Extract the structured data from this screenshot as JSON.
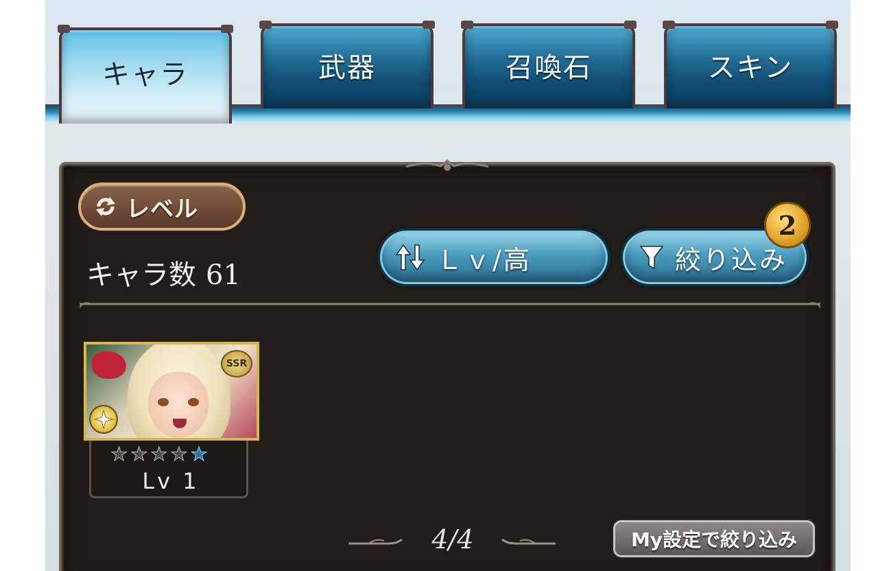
{
  "tabs": [
    {
      "label": "キャラ",
      "active": true
    },
    {
      "label": "武器",
      "active": false
    },
    {
      "label": "召喚石",
      "active": false
    },
    {
      "label": "スキン",
      "active": false
    }
  ],
  "panel": {
    "level_toggle_label": "レベル",
    "count_label": "キャラ数",
    "count_value": "61",
    "sort_label": "Ｌｖ/高",
    "filter_label": "絞り込み",
    "filter_badge": "2",
    "my_filter_label": "My設定で絞り込み",
    "pager": "4/4"
  },
  "characters": [
    {
      "rarity": "SSR",
      "stars_total": 5,
      "stars_highlighted": 1,
      "level": "Lv 1",
      "element_icon": "light-element-icon"
    }
  ],
  "colors": {
    "tab_active": "#9fdaf0",
    "tab_inactive": "#236f98",
    "panel_bg": "#231d19",
    "badge_gold": "#e3a52c"
  }
}
